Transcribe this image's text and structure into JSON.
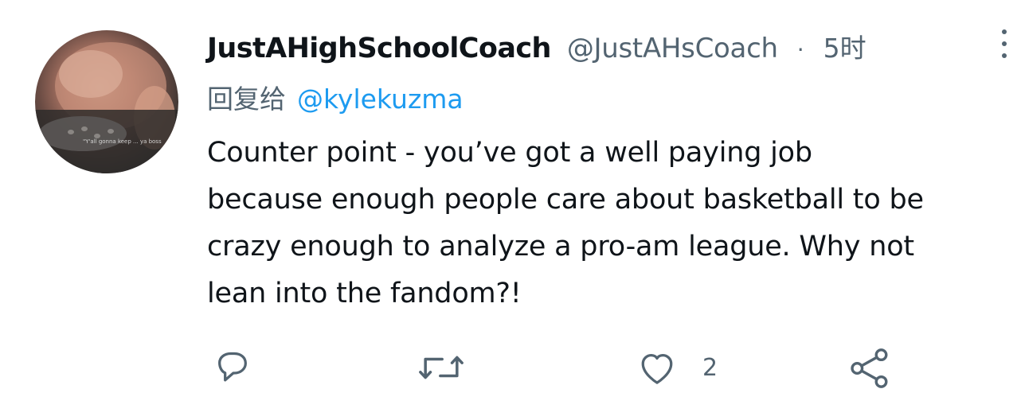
{
  "tweet": {
    "display_name": "JustAHighSchoolCoach",
    "handle": "@JustAHsCoach",
    "separator": "·",
    "time": "5时",
    "reply_prefix": "回复给",
    "reply_to": "@kylekuzma",
    "lines": [
      "Counter point - you’ve got a well paying job",
      "because enough people care about basketball to be",
      "crazy enough to analyze a pro-am league. Why not",
      "lean into the fandom?!"
    ],
    "avatar_caption": "\"Y'all gonna keep ... ya boss",
    "actions": {
      "reply_icon": "reply-icon",
      "retweet_icon": "retweet-icon",
      "like_icon": "heart-icon",
      "like_count": "2",
      "share_icon": "share-icon"
    }
  },
  "colors": {
    "text_primary": "#0f1419",
    "text_secondary": "#536471",
    "link": "#1d9bf0"
  }
}
